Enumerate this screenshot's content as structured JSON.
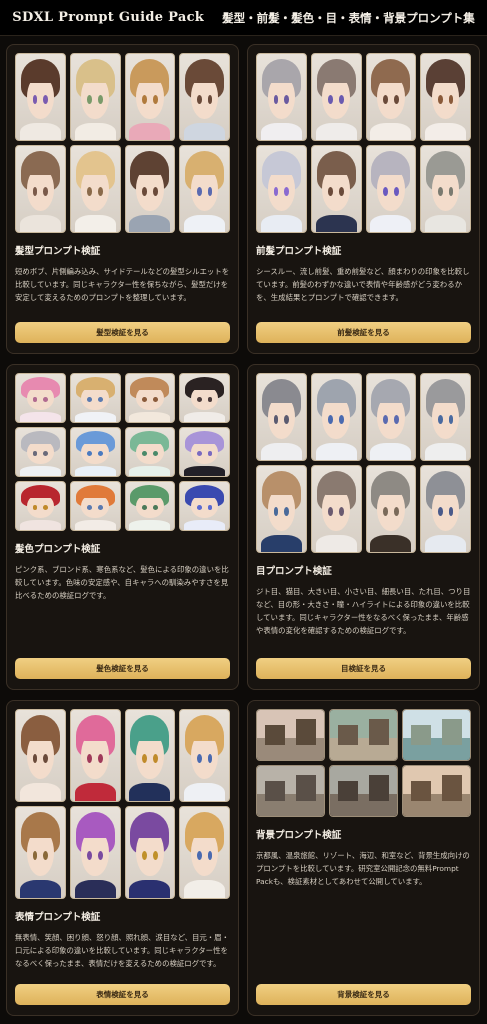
{
  "header": {
    "title": "SDXL Prompt Guide Pack",
    "subtitle": "髪型・前髪・髪色・目・表情・背景プロンプト集"
  },
  "cards": [
    {
      "title": "髪型プロンプト検証",
      "description": "短めボブ、片側編み込み、サイドテールなどの髪型シルエットを比較しています。同じキャラクター性を保ちながら、髪型だけを安定して変えるためのプロンプトを整理しています。",
      "button": "髪型検証を見る",
      "thumbs": [
        {
          "hair": "#5a3b2c",
          "eye": "#7a5bb0",
          "body": "#efe9e2"
        },
        {
          "hair": "#d9c08a",
          "eye": "#7a9a6a",
          "body": "#f2ece4"
        },
        {
          "hair": "#c99a5c",
          "eye": "#b07a3c",
          "body": "#e9a9b8"
        },
        {
          "hair": "#6a4a38",
          "eye": "#6a4a3a",
          "body": "#cfd6e0"
        },
        {
          "hair": "#8a6a52",
          "eye": "#7a5a4a",
          "body": "#ebe4dc"
        },
        {
          "hair": "#e3c48e",
          "eye": "#8a6a4a",
          "body": "#f3efe9"
        },
        {
          "hair": "#5e4233",
          "eye": "#6a4a3a",
          "body": "#9aa4b2"
        },
        {
          "hair": "#d8b070",
          "eye": "#5a6ab0",
          "body": "#eef1f6"
        }
      ]
    },
    {
      "title": "前髪プロンプト検証",
      "description": "シースルー、流し前髪、重め前髪など、顔まわりの印象を比較しています。前髪のわずかな違いで表情や年齢感がどう変わるかを、生成結果とプロンプトで確認できます。",
      "button": "前髪検証を見る",
      "thumbs": [
        {
          "hair": "#a9a6ab",
          "eye": "#6a5aa0",
          "body": "#f0eef0"
        },
        {
          "hair": "#8a7a72",
          "eye": "#6a5ab0",
          "body": "#efecea"
        },
        {
          "hair": "#8f6a4f",
          "eye": "#6a4a3a",
          "body": "#f3ede7"
        },
        {
          "hair": "#5a4035",
          "eye": "#8a5a3a",
          "body": "#f3ede8"
        },
        {
          "hair": "#c6c8d6",
          "eye": "#8a6ad0",
          "body": "#e8ecf3"
        },
        {
          "hair": "#7a5e4c",
          "eye": "#6a4a3a",
          "body": "#2c3450"
        },
        {
          "hair": "#b7b4bf",
          "eye": "#6a5ac0",
          "body": "#eef0f6"
        },
        {
          "hair": "#9a9a94",
          "eye": "#7a7a70",
          "body": "#e8e6e1"
        }
      ]
    },
    {
      "title": "髪色プロンプト検証",
      "description": "ピンク系、ブロンド系、寒色系など、髪色による印象の違いを比較しています。色味の安定感や、自キャラへの馴染みやすさを見比べるための検証ログです。",
      "button": "髪色検証を見る",
      "thumbs": [
        {
          "hair": "#e78ab0",
          "eye": "#b06a90",
          "body": "#f4e4ea"
        },
        {
          "hair": "#d8b070",
          "eye": "#5a7ab0",
          "body": "#f0f2f6"
        },
        {
          "hair": "#c08a5a",
          "eye": "#8a5a3a",
          "body": "#f2e8dc"
        },
        {
          "hair": "#2a2222",
          "eye": "#4a3a3a",
          "body": "#f0ece8"
        },
        {
          "hair": "#b9b9bf",
          "eye": "#6a6a7a",
          "body": "#eef0f2"
        },
        {
          "hair": "#6a9ad8",
          "eye": "#4a7ac0",
          "body": "#e8f0f8"
        },
        {
          "hair": "#7ab896",
          "eye": "#4a8a6a",
          "body": "#e6f0ea"
        },
        {
          "hair": "#a894d8",
          "eye": "#7a6ac0",
          "body": "#222028"
        },
        {
          "hair": "#b8262e",
          "eye": "#c08a2a",
          "body": "#f0e4e0"
        },
        {
          "hair": "#e07a3a",
          "eye": "#5a7ab0",
          "body": "#f2ece6"
        },
        {
          "hair": "#5a9a6a",
          "eye": "#4a7a5a",
          "body": "#eef2ec"
        },
        {
          "hair": "#3a4ab0",
          "eye": "#5a6ad0",
          "body": "#e8ecf8"
        }
      ]
    },
    {
      "title": "目プロンプト検証",
      "description": "ジト目、猫目、大きい目、小さい目、細長い目、たれ目、つり目など、目の形・大きさ・瞳・ハイライトによる印象の違いを比較しています。同じキャラクター性をなるべく保ったまま、年齢感や表情の変化を確認するための検証ログです。",
      "button": "目検証を見る",
      "thumbs": [
        {
          "hair": "#8a8a90",
          "eye": "#5a5a70",
          "body": "#eeeef0"
        },
        {
          "hair": "#9ea4ae",
          "eye": "#4a6ab0",
          "body": "#eef0f4"
        },
        {
          "hair": "#a6a8b0",
          "eye": "#5a6ab0",
          "body": "#eef0f4"
        },
        {
          "hair": "#9a9a9c",
          "eye": "#4a6aa0",
          "body": "#eeeeee"
        },
        {
          "hair": "#b8906a",
          "eye": "#4a6a9a",
          "body": "#283e6a"
        },
        {
          "hair": "#8a7a70",
          "eye": "#6a5a70",
          "body": "#eeeae6"
        },
        {
          "hair": "#8e8a84",
          "eye": "#7a6a5a",
          "body": "#3a3028"
        },
        {
          "hair": "#8e9096",
          "eye": "#4a5a8a",
          "body": "#e6eaf0"
        }
      ]
    },
    {
      "title": "表情プロンプト検証",
      "description": "無表情、笑顔、困り顔、怒り顔、照れ顔、涙目など、目元・眉・口元による印象の違いを比較しています。同じキャラクター性をなるべく保ったまま、表情だけを変えるための検証ログです。",
      "button": "表情検証を見る",
      "thumbs": [
        {
          "hair": "#8a5e40",
          "eye": "#6a4a3a",
          "body": "#f2e6dc"
        },
        {
          "hair": "#e06a9a",
          "eye": "#a03a5a",
          "body": "#c02a3a"
        },
        {
          "hair": "#4aa08a",
          "eye": "#c08a2a",
          "body": "#22305a"
        },
        {
          "hair": "#d8a860",
          "eye": "#4a6ab0",
          "body": "#eef0f4"
        },
        {
          "hair": "#a8784a",
          "eye": "#8a6a3a",
          "body": "#2a3870"
        },
        {
          "hair": "#a85ac0",
          "eye": "#7a4aa0",
          "body": "#2a2e58"
        },
        {
          "hair": "#7a4aa0",
          "eye": "#c0902a",
          "body": "#2a3070"
        },
        {
          "hair": "#d8a860",
          "eye": "#4a6ab0",
          "body": "#f2eee8"
        }
      ]
    },
    {
      "title": "背景プロンプト検証",
      "description": "京都風、温泉旅館、リゾート、海辺、和室など、背景生成向けのプロンプトを比較しています。研究室公開記念の無料Prompt Packも、検証素材としてあわせて公開しています。",
      "button": "背景検証を見る",
      "thumbs": [
        {
          "sky": "#d8c4b6",
          "ground": "#9a8a7a",
          "bld": "#5a4a3a"
        },
        {
          "sky": "#9ab0a0",
          "ground": "#b8aa94",
          "bld": "#6a5a4a"
        },
        {
          "sky": "#cfe0e6",
          "ground": "#7aa0a0",
          "bld": "#8a9a8a"
        },
        {
          "sky": "#b8b2a8",
          "ground": "#8a7e70",
          "bld": "#5a5048"
        },
        {
          "sky": "#a8a8a0",
          "ground": "#7a6e62",
          "bld": "#4a4038"
        },
        {
          "sky": "#e0c8b0",
          "ground": "#9a8670",
          "bld": "#6a5440"
        }
      ]
    }
  ],
  "colors": {
    "accent": "#e4b865",
    "background": "#0d0b09",
    "card": "#181410"
  }
}
